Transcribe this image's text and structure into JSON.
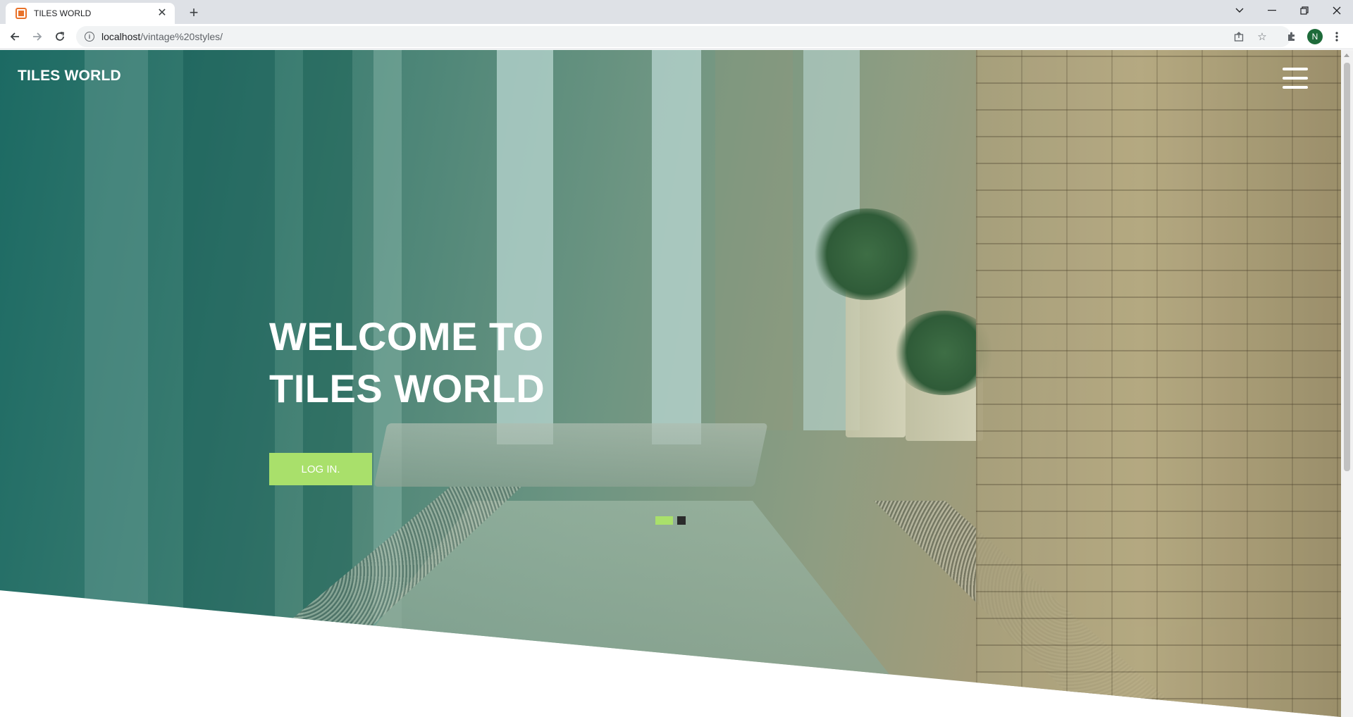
{
  "browser": {
    "tab_title": "TILES WORLD",
    "url_host": "localhost",
    "url_path": "/vintage%20styles/",
    "profile_initial": "N"
  },
  "site": {
    "logo": "TILES WORLD",
    "hero_line1": "WELCOME TO",
    "hero_line2": "TILES WORLD",
    "login_label": "LOG IN."
  },
  "slider": {
    "total": 2,
    "active_index": 0
  },
  "colors": {
    "accent": "#a9e06b",
    "dot_inactive": "#2b2b2b",
    "hero_teal": "#1c6a63"
  },
  "icons": [
    "favicon-icon",
    "close-icon",
    "plus-icon",
    "chevron-down-icon",
    "minimize-icon",
    "restore-icon",
    "window-close-icon",
    "back-icon",
    "forward-icon",
    "reload-icon",
    "info-icon",
    "share-icon",
    "star-icon",
    "extensions-icon",
    "more-icon",
    "hamburger-icon"
  ]
}
